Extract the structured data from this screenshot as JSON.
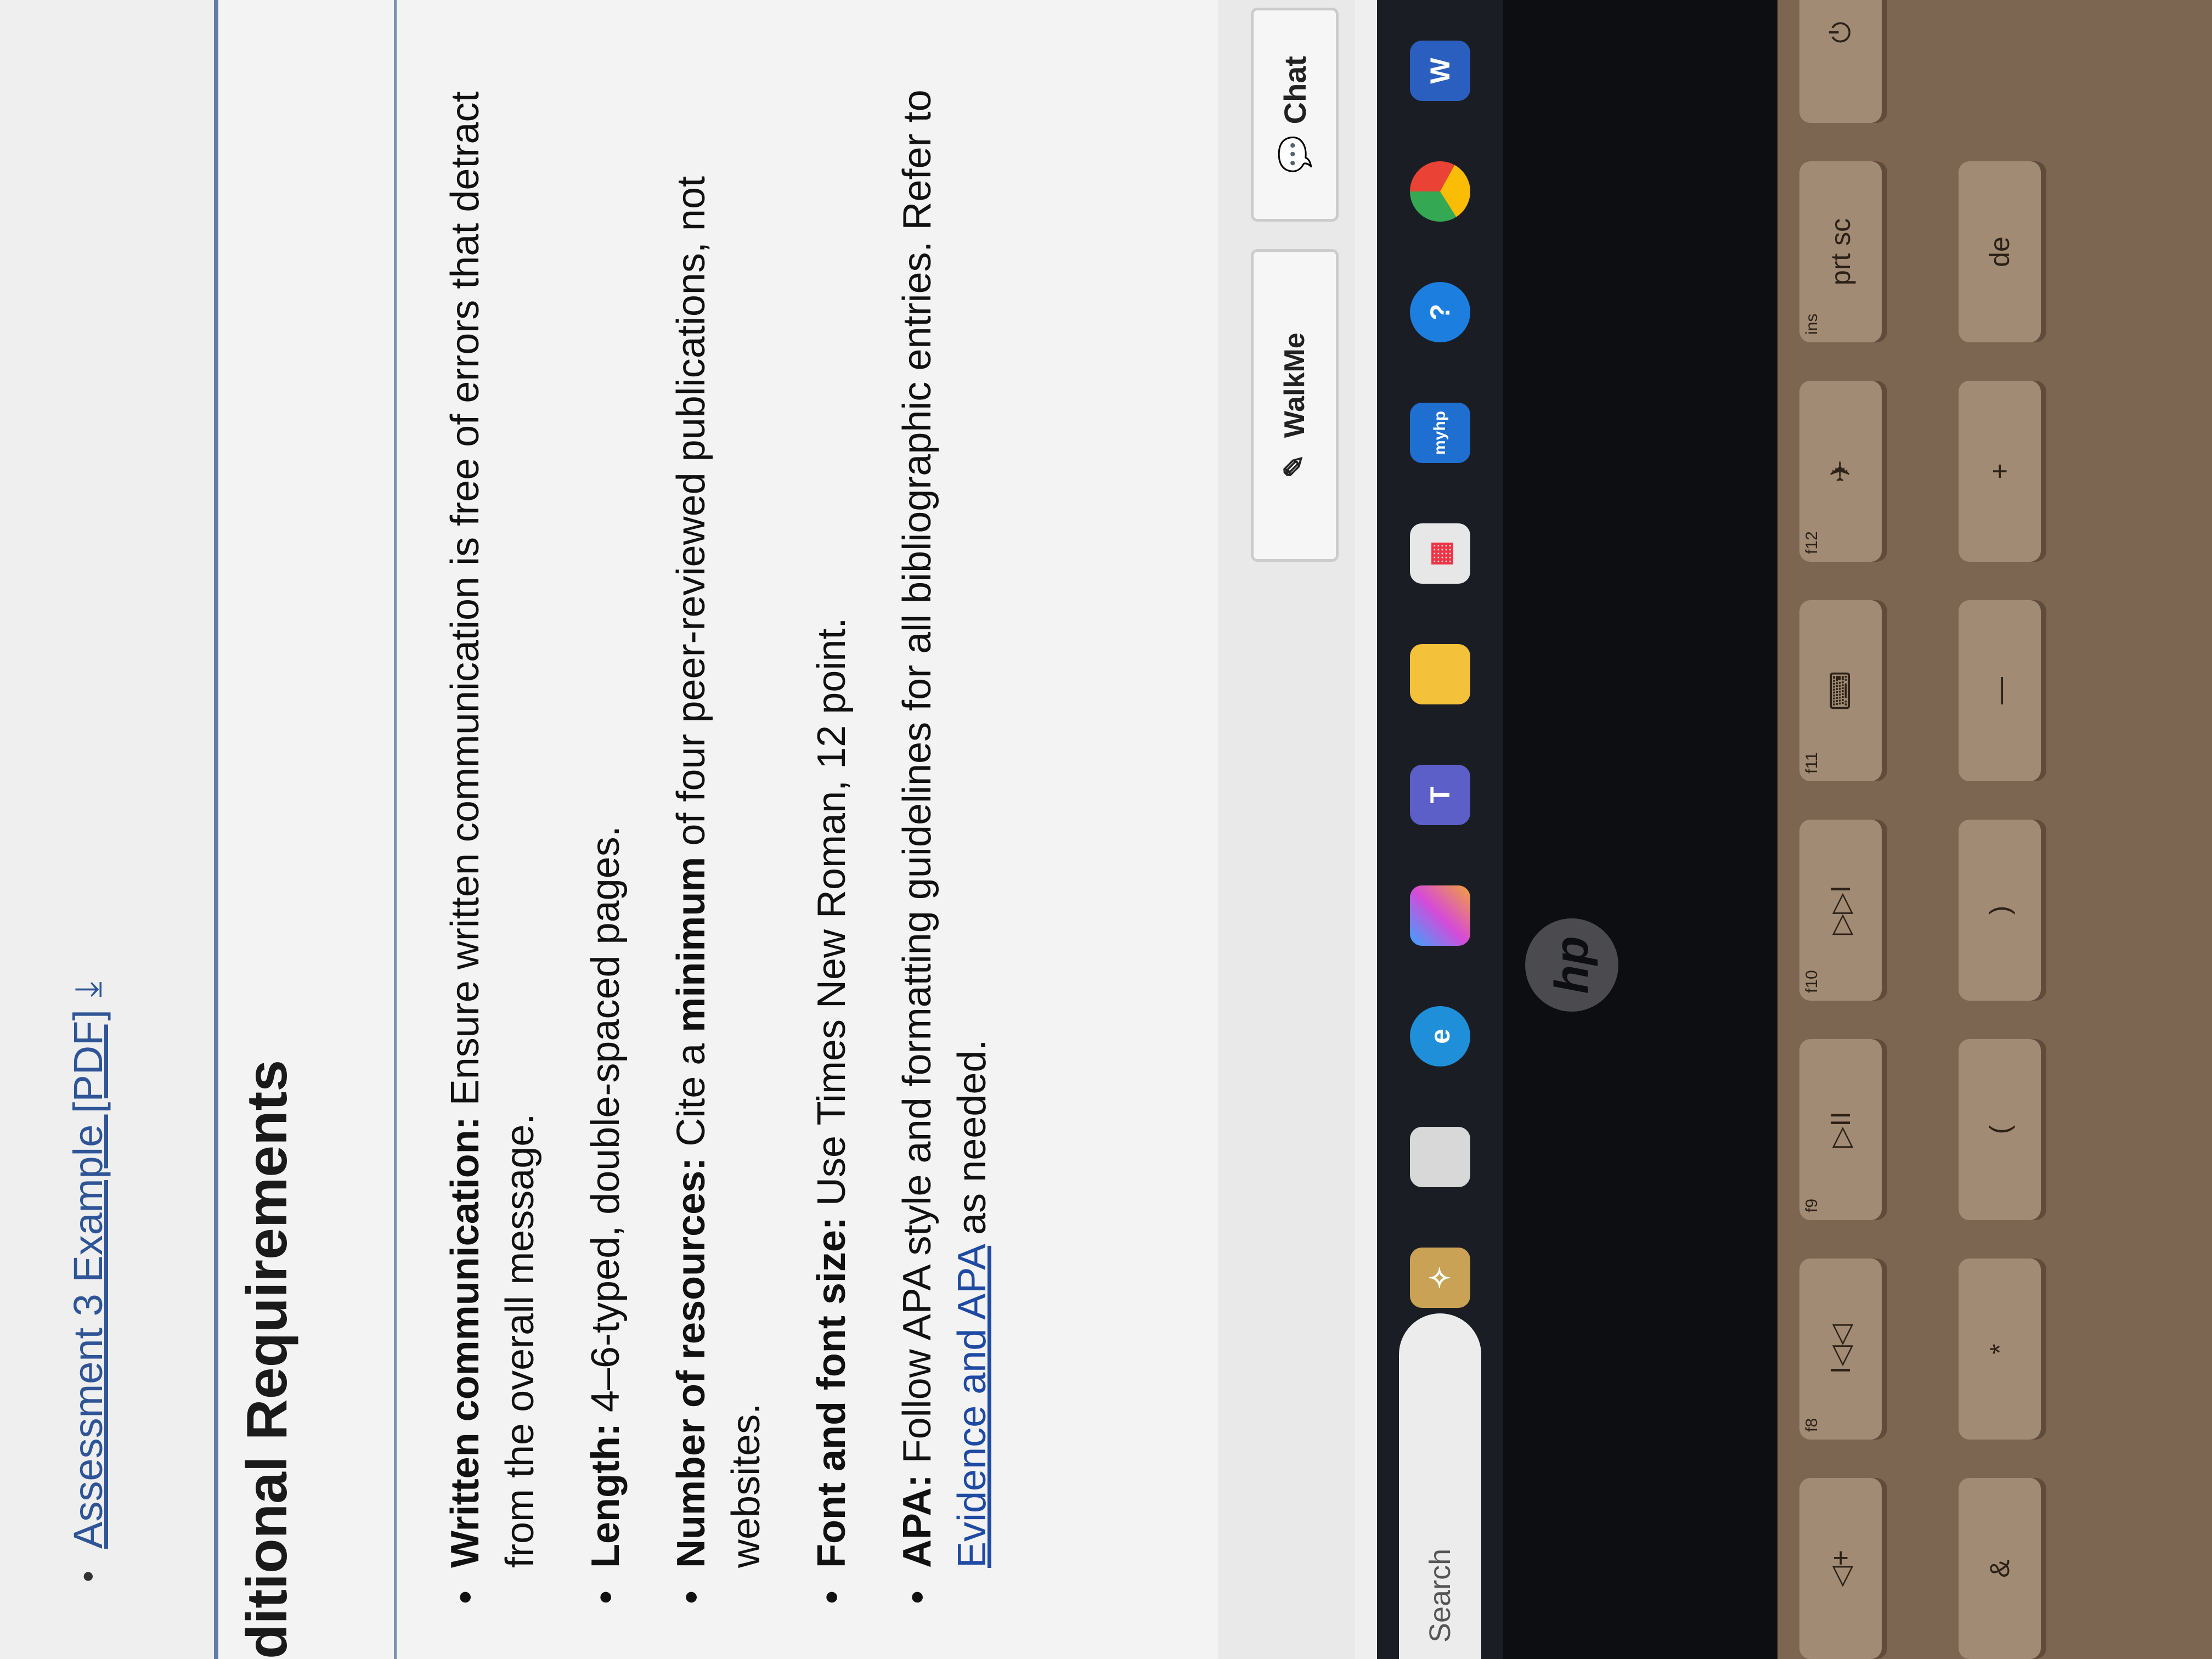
{
  "top_link": {
    "label": "Assessment 3 Example [PDF]",
    "icon": "download-icon"
  },
  "section": {
    "title": "ditional Requirements",
    "items": [
      {
        "label": "Written communication:",
        "text": " Ensure written communication is free of errors that detract from the overall message."
      },
      {
        "label": "Length:",
        "text": " 4–6-typed, double-spaced pages."
      },
      {
        "label": "Number of resources:",
        "text_pre": " Cite a ",
        "emphasis": "minimum",
        "text_post": " of four peer-reviewed publications, not websites."
      },
      {
        "label": "Font and font size:",
        "text": " Use Times New Roman, 12 point."
      },
      {
        "label": "APA:",
        "text": " Follow APA style and formatting guidelines for all bibliographic entries. Refer to ",
        "link": "Evidence and APA",
        "text_post": " as needed."
      }
    ]
  },
  "help": {
    "walkme_label": "WalkMe",
    "chat_label": "Chat"
  },
  "taskbar": {
    "search_placeholder": "Search",
    "icons": [
      "widget-icon",
      "taskview-icon",
      "edge-icon",
      "copilot-icon",
      "teams-icon",
      "file-explorer-icon",
      "store-icon",
      "myhp-icon",
      "help-icon",
      "chrome-icon",
      "word-icon"
    ],
    "myhp_label": "myhp",
    "word_label": "W"
  },
  "laptop": {
    "brand": "hp"
  },
  "keyboard": {
    "function_keys": [
      {
        "sub": "f8",
        "glyph": "I◁◁"
      },
      {
        "sub": "f9",
        "glyph": "▷II"
      },
      {
        "sub": "f10",
        "glyph": "▷▷I"
      },
      {
        "sub": "f11",
        "glyph": "⌨"
      },
      {
        "sub": "f12",
        "glyph": "✈"
      },
      {
        "sub": "ins",
        "glyph": "prt sc"
      },
      {
        "sub": "",
        "glyph": "⏻"
      }
    ],
    "number_keys": [
      "*",
      "(",
      ")",
      "—",
      "+"
    ],
    "speaker_key": "◁+",
    "amp_key": "&",
    "delete_partial": "de"
  }
}
